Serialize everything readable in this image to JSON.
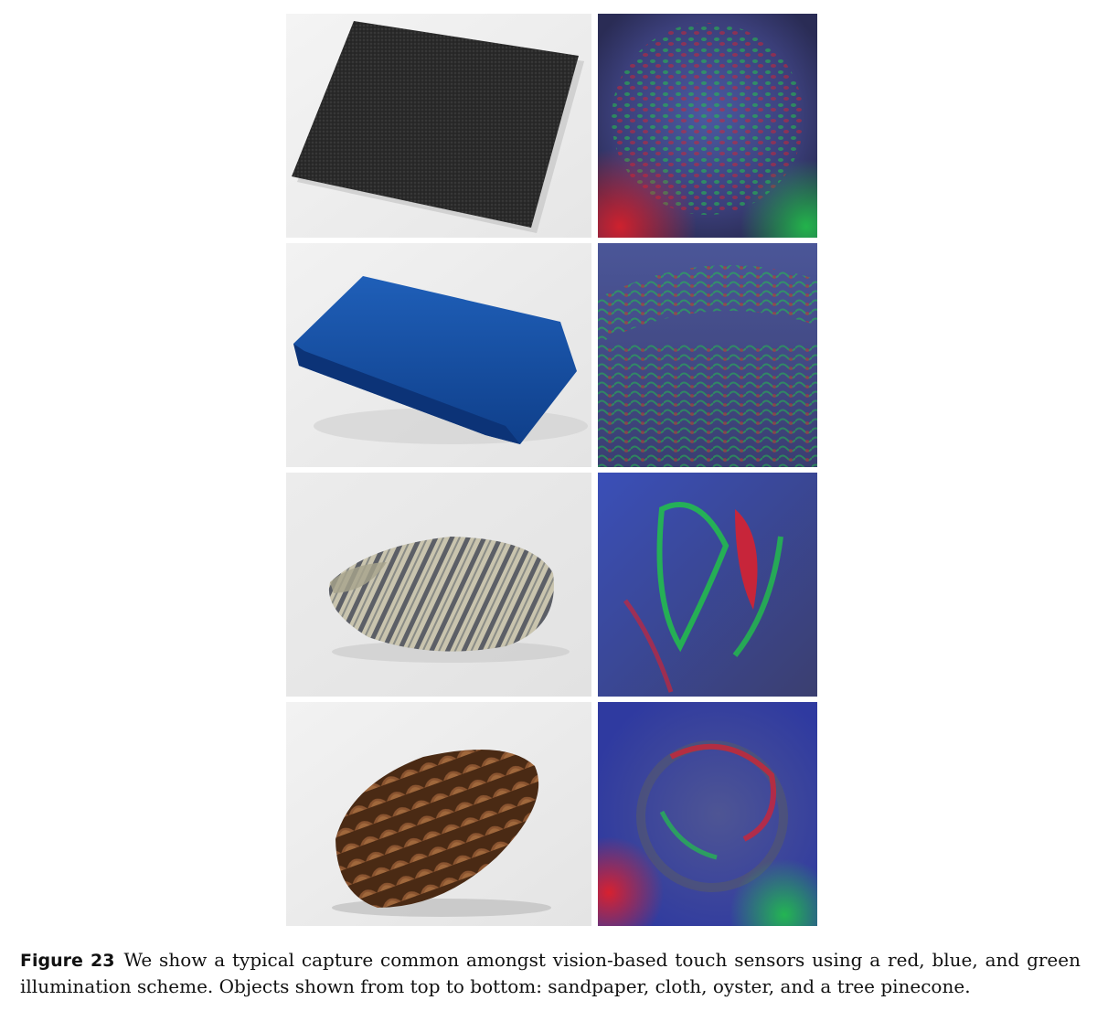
{
  "figure": {
    "label": "Figure 23",
    "caption_text": "We show a typical capture common amongst vision-based touch sensors using a red, blue, and green illumination scheme. Objects shown from top to bottom: sandpaper, cloth, oyster, and a tree pinecone."
  },
  "rows": [
    {
      "object_icon": "sandpaper-photo",
      "capture_icon": "sandpaper-tactile-capture"
    },
    {
      "object_icon": "cloth-photo",
      "capture_icon": "cloth-tactile-capture"
    },
    {
      "object_icon": "oyster-photo",
      "capture_icon": "oyster-tactile-capture"
    },
    {
      "object_icon": "pinecone-photo",
      "capture_icon": "pinecone-tactile-capture"
    }
  ],
  "colors": {
    "illumination_red": "#e0202a",
    "illumination_green": "#22c24a",
    "illumination_blue": "#2a4fd8",
    "background_gray": "#ececec"
  }
}
